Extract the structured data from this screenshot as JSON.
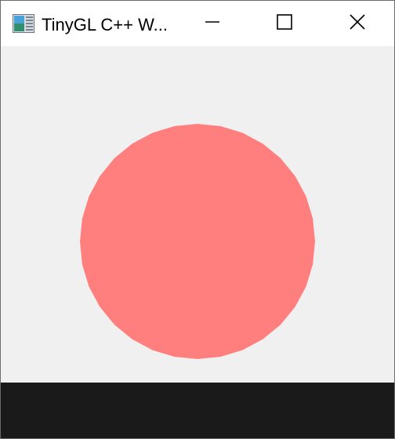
{
  "window": {
    "title": "TinyGL C++ W...",
    "app_icon": "window-app-icon",
    "minimize_icon": "minimize-icon",
    "maximize_icon": "maximize-icon",
    "close_icon": "close-icon"
  },
  "canvas": {
    "background_color": "#f0f0f0",
    "shape": "circle",
    "circle_color": "#ff7f7f"
  },
  "colors": {
    "titlebar_bg": "#ffffff",
    "bottom_bar_bg": "#1a1a1a"
  }
}
